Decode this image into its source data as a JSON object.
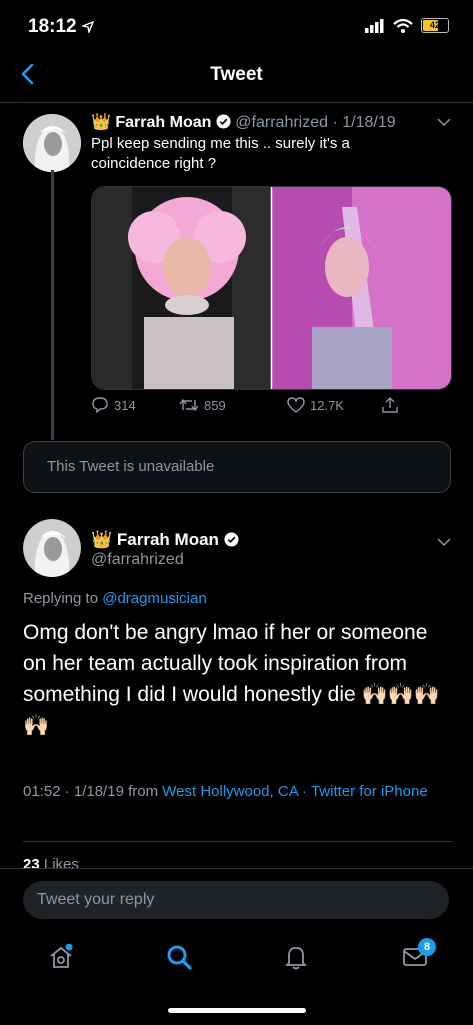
{
  "status": {
    "time": "18:12",
    "battery": "42"
  },
  "header": {
    "title": "Tweet"
  },
  "tweet1": {
    "crown": "👑",
    "name": "Farrah Moan",
    "handle": "@farrahrized",
    "date": "· 1/18/19",
    "text": "Ppl keep sending me this .. surely it's a coincidence right ?",
    "replies": "314",
    "retweets": "859",
    "likes": "12.7K"
  },
  "unavailable": {
    "text": "This Tweet is unavailable"
  },
  "tweet2": {
    "crown": "👑",
    "name": "Farrah Moan",
    "handle": "@farrahrized",
    "replying_prefix": "Replying to",
    "replying_to": "@dragmusician",
    "text": "Omg don't be angry lmao if her or someone on her team actually took inspiration from something I did I would honestly die",
    "emoji": "🙌🏻🙌🏻🙌🏻🙌🏻",
    "time": "01:52 · 1/18/19 from",
    "location": "West Hollywood, CA",
    "source": "· Twitter for iPhone",
    "likes_count": "23",
    "likes_label": "Likes"
  },
  "reply": {
    "placeholder": "Tweet your reply"
  },
  "tabbar": {
    "messages_badge": "8"
  },
  "colors": {
    "accent": "#1d9bf0",
    "muted": "#8b98a5",
    "background": "#000000"
  }
}
